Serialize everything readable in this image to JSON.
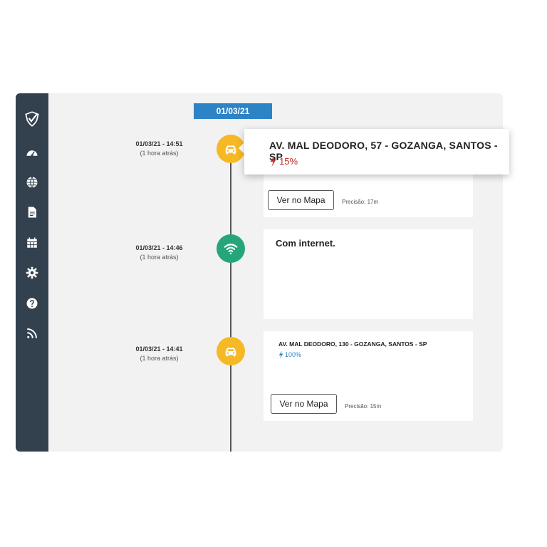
{
  "colors": {
    "sidebar": "#33414f",
    "accent_blue": "#2c83c6",
    "car_node": "#f6b824",
    "wifi_node": "#26a57a",
    "battery_low": "#c42a2a",
    "battery_full": "#2c83c6"
  },
  "sidebar": {
    "logo_icon": "shield-check-logo",
    "items": [
      {
        "icon": "dashboard-icon"
      },
      {
        "icon": "globe-icon"
      },
      {
        "icon": "document-icon"
      },
      {
        "icon": "calendar-icon"
      },
      {
        "icon": "gear-icon"
      },
      {
        "icon": "help-icon"
      },
      {
        "icon": "rss-icon"
      }
    ]
  },
  "date_header": "01/03/21",
  "events": [
    {
      "type": "car",
      "time": "01/03/21 - 14:51",
      "relative": "(1 hora atrás)",
      "address": "AV. MAL DEODORO, 57 - GOZANGA, SANTOS - SP",
      "battery": "15%",
      "button": "Ver no Mapa",
      "precision": "Precisão: 17m"
    },
    {
      "type": "wifi",
      "time": "01/03/21 - 14:46",
      "relative": "(1 hora atrás)",
      "message": "Com internet."
    },
    {
      "type": "car",
      "time": "01/03/21 - 14:41",
      "relative": "(1 hora atrás)",
      "address": "AV. MAL DEODORO, 130 - GOZANGA, SANTOS - SP",
      "battery": "100%",
      "button": "Ver no Mapa",
      "precision": "Precisão: 15m"
    }
  ]
}
